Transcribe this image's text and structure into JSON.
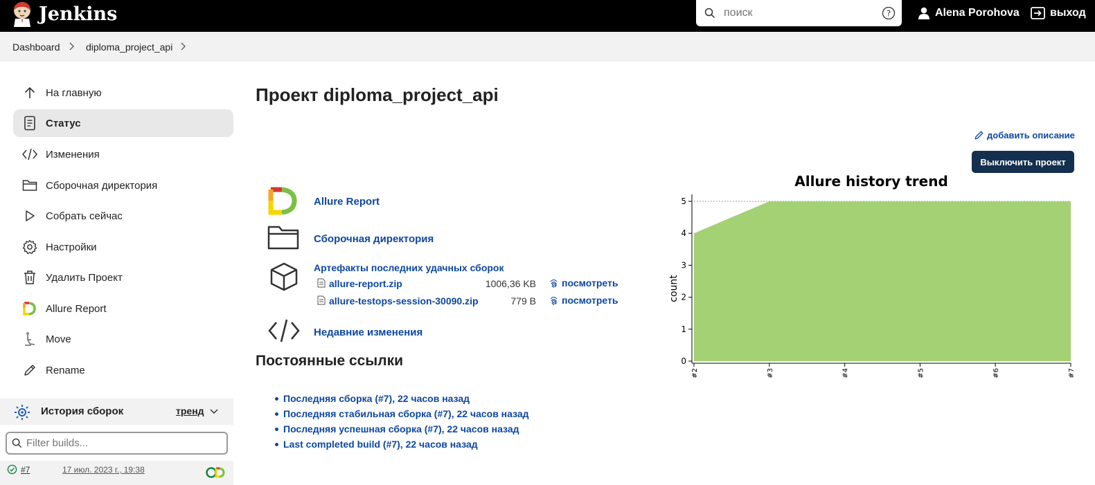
{
  "header": {
    "app_title": "Jenkins",
    "search_placeholder": "поиск",
    "user_name": "Alena Porohova",
    "logout_label": "выход"
  },
  "breadcrumb": [
    "Dashboard",
    "diploma_project_api"
  ],
  "sidebar": {
    "items": [
      {
        "label": "На главную",
        "icon": "arrow-up-icon"
      },
      {
        "label": "Статус",
        "icon": "document-icon",
        "active": true
      },
      {
        "label": "Изменения",
        "icon": "code-icon"
      },
      {
        "label": "Сборочная директория",
        "icon": "folder-icon"
      },
      {
        "label": "Собрать сейчас",
        "icon": "play-icon"
      },
      {
        "label": "Настройки",
        "icon": "gear-icon"
      },
      {
        "label": "Удалить Проект",
        "icon": "trash-icon"
      },
      {
        "label": "Allure Report",
        "icon": "allure-icon"
      },
      {
        "label": "Move",
        "icon": "move-icon"
      },
      {
        "label": "Rename",
        "icon": "pencil-icon"
      }
    ]
  },
  "history": {
    "title": "История сборок",
    "trend_label": "тренд",
    "filter_placeholder": "Filter builds...",
    "builds": [
      {
        "number": "#7",
        "date": "17 июл. 2023 г., 19:38"
      }
    ]
  },
  "main": {
    "title": "Проект diploma_project_api",
    "add_description": "добавить описание",
    "disable_button": "Выключить проект",
    "links": {
      "allure_report": "Allure Report",
      "workspace": "Сборочная директория",
      "artifacts_title": "Артефакты последних удачных сборок",
      "recent_changes": "Недавние изменения"
    },
    "artifacts": [
      {
        "name": "allure-report.zip",
        "size": "1006,36 KB",
        "view": "посмотреть"
      },
      {
        "name": "allure-testops-session-30090.zip",
        "size": "779 B",
        "view": "посмотреть"
      }
    ],
    "permalinks_title": "Постоянные ссылки",
    "permalinks": [
      "Последняя сборка (#7), 22 часов назад",
      "Последняя стабильная сборка (#7), 22 часов назад",
      "Последняя успешная сборка (#7), 22 часов назад",
      "Last completed build (#7), 22 часов назад"
    ]
  },
  "colors": {
    "header_bg": "#000000",
    "link": "#0d47a1",
    "button_bg": "#14304e",
    "chart_fill": "#a3d174"
  },
  "chart_data": {
    "type": "area",
    "title": "Allure history trend",
    "xlabel": "",
    "ylabel": "count",
    "categories": [
      "#2",
      "#3",
      "#4",
      "#5",
      "#6",
      "#7"
    ],
    "series": [
      {
        "values": [
          4,
          5,
          5,
          5,
          5,
          5
        ]
      }
    ],
    "ylim": [
      0,
      5
    ],
    "yticks": [
      0,
      1,
      2,
      3,
      4,
      5
    ],
    "grid": true
  }
}
